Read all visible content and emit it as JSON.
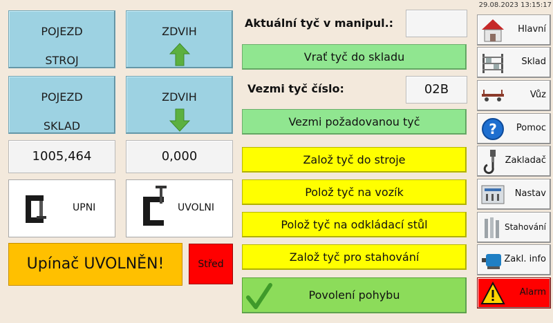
{
  "datetime": "29.08.2023 13:15:17",
  "left": {
    "pojezd_stroj": {
      "line1": "POJEZD",
      "line2": "STROJ"
    },
    "zdvih_up": {
      "label": "ZDVIH"
    },
    "pojezd_sklad": {
      "line1": "POJEZD",
      "line2": "SKLAD"
    },
    "zdvih_down": {
      "label": "ZDVIH"
    },
    "position_value": "1005,464",
    "lift_value": "0,000",
    "upni_label": "UPNI",
    "uvolni_label": "UVOLNI",
    "clamp_status": "Upínač UVOLNĚN!",
    "stred_label": "Střed"
  },
  "center": {
    "current_bar_label": "Aktuální tyč v manipul.:",
    "current_bar_value": "",
    "return_bar_button": "Vrať tyč do skladu",
    "take_bar_label": "Vezmi tyč číslo:",
    "take_bar_value": "02B",
    "take_requested_button": "Vezmi požadovanou tyč",
    "load_machine_button": "Založ tyč do stroje",
    "place_cart_button": "Polož tyč na vozík",
    "place_table_button": "Polož tyč na odkládací stůl",
    "load_pull_button": "Založ tyč pro stahování",
    "motion_enable_button": "Povolení pohybu"
  },
  "nav": [
    {
      "label": "Hlavní",
      "icon": "house-icon"
    },
    {
      "label": "Sklad",
      "icon": "warehouse-rack-icon"
    },
    {
      "label": "Vůz",
      "icon": "cart-icon"
    },
    {
      "label": "Pomoc",
      "icon": "help-icon"
    },
    {
      "label": "Zakladač",
      "icon": "crane-hook-icon"
    },
    {
      "label": "Nastav",
      "icon": "settings-panel-icon"
    },
    {
      "label": "Stahování",
      "icon": "pulling-icon"
    },
    {
      "label": "Zakl. info",
      "icon": "motor-icon"
    },
    {
      "label": "Alarm",
      "icon": "warning-icon"
    }
  ],
  "colors": {
    "background": "#f3e9dc",
    "blue_button": "#9dd2e2",
    "green_button": "#90e690",
    "yellow_button": "#ffff00",
    "clamp_status_bg": "#ffc000",
    "stred_bg": "#ff0000",
    "alarm_bg": "#ff0000",
    "arrow_green": "#5cb040"
  }
}
